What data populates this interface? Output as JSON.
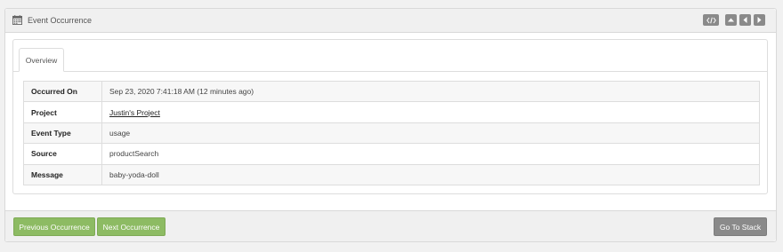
{
  "header": {
    "title": "Event Occurrence",
    "icons": [
      "calendar-icon",
      "code-icon",
      "chevron-up-icon",
      "chevron-left-icon",
      "chevron-right-icon"
    ]
  },
  "tabs": [
    {
      "label": "Overview",
      "active": true
    }
  ],
  "details": {
    "rows": [
      {
        "label": "Occurred On",
        "value": "Sep 23, 2020 7:41:18 AM (12 minutes ago)"
      },
      {
        "label": "Project",
        "value": "Justin's Project",
        "link": true
      },
      {
        "label": "Event Type",
        "value": "usage"
      },
      {
        "label": "Source",
        "value": "productSearch"
      },
      {
        "label": "Message",
        "value": "baby-yoda-doll"
      }
    ]
  },
  "footer": {
    "previous_label": "Previous Occurrence",
    "next_label": "Next Occurrence",
    "stack_label": "Go To Stack"
  },
  "colors": {
    "accent_green": "#8dbb63",
    "neutral_button": "#8a8a8a",
    "header_bg": "#f0f0f0"
  }
}
